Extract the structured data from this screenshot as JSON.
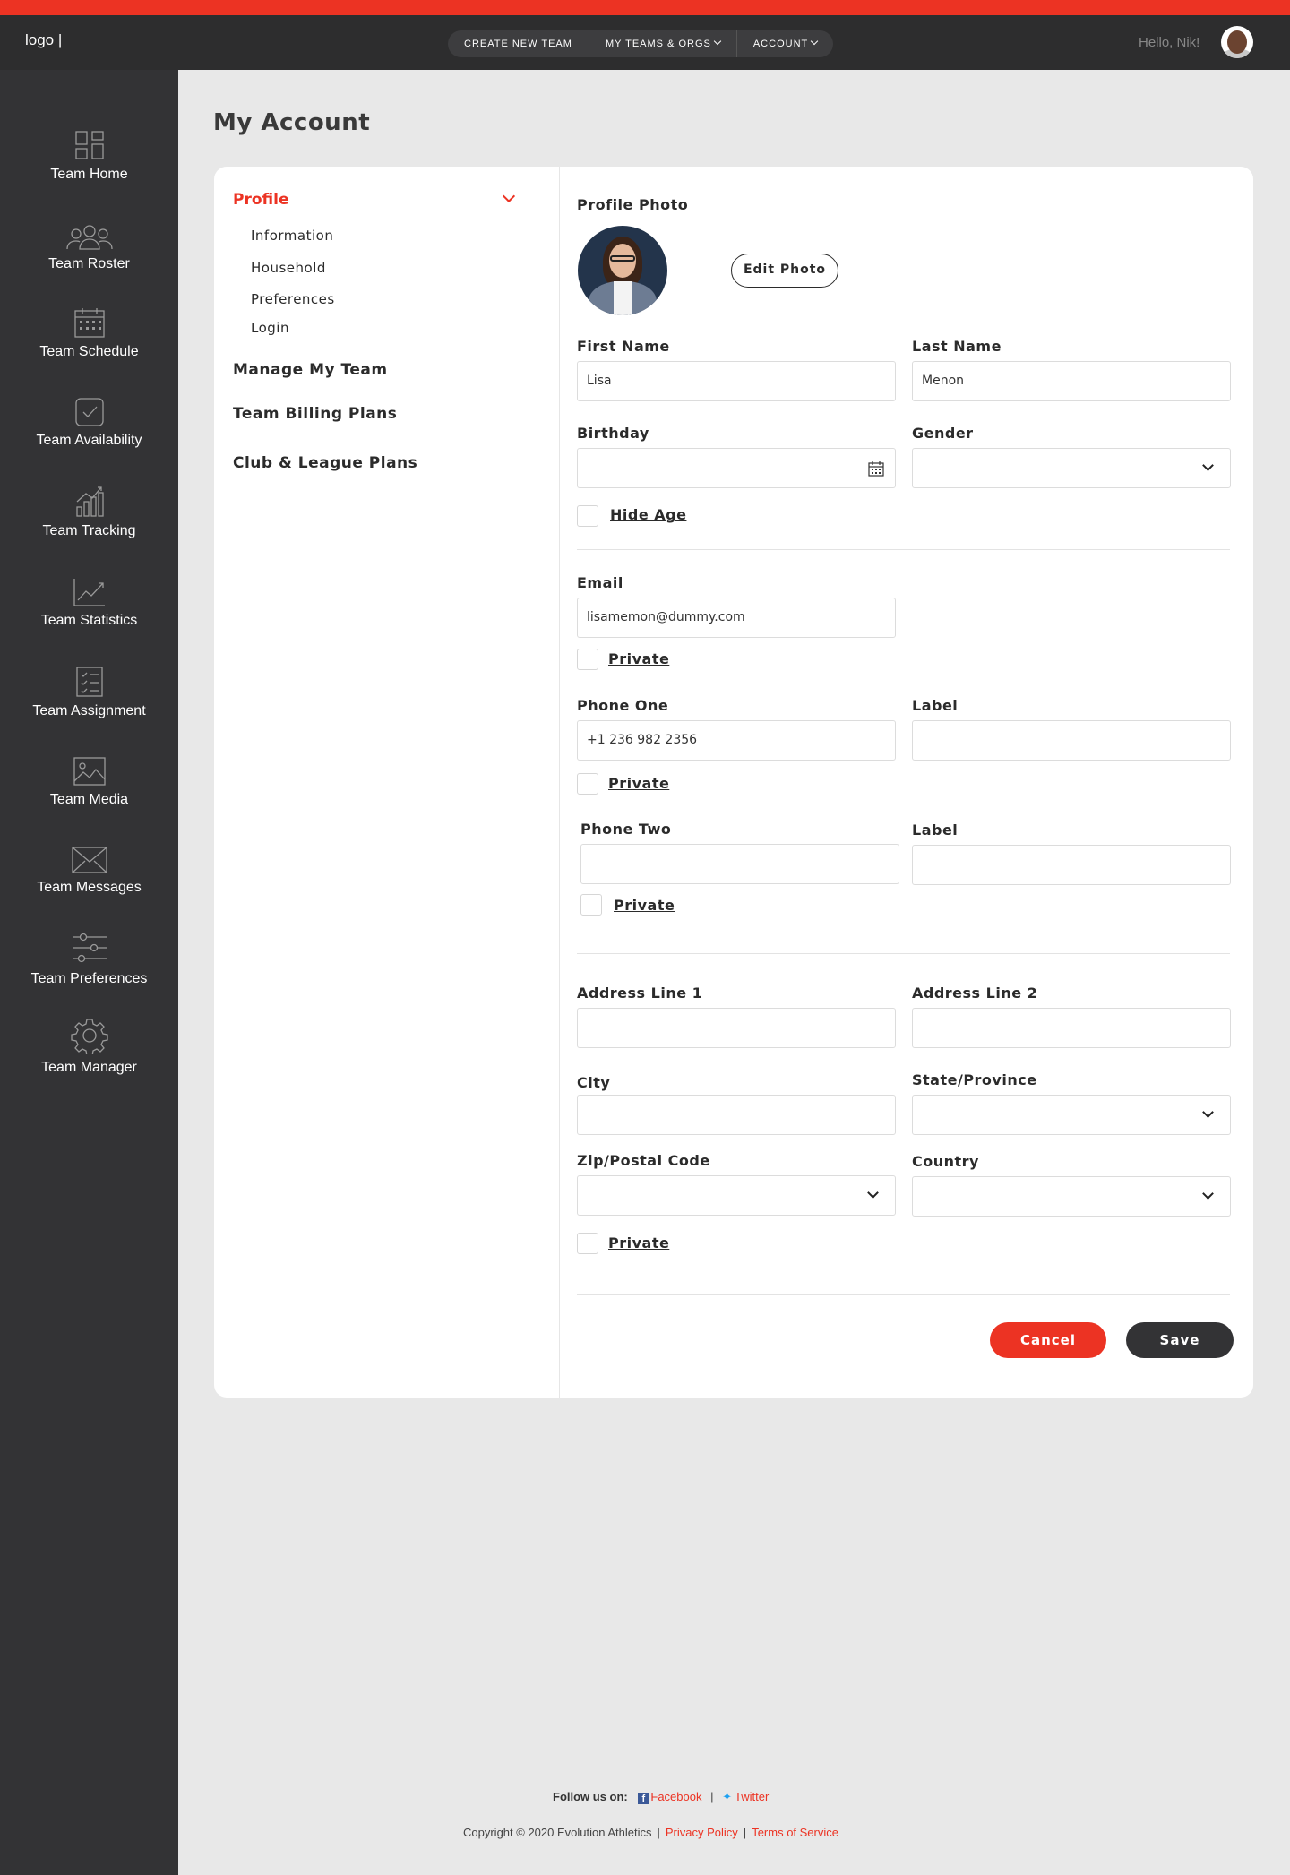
{
  "header": {
    "logo": "logo |",
    "nav": [
      "CREATE NEW TEAM",
      "MY TEAMS & ORGS",
      "ACCOUNT"
    ],
    "greeting": "Hello, Nik!"
  },
  "sidebar": {
    "items": [
      {
        "label": "Team Home",
        "icon": "dashboard-icon"
      },
      {
        "label": "Team Roster",
        "icon": "users-icon"
      },
      {
        "label": "Team Schedule",
        "icon": "calendar-icon"
      },
      {
        "label": "Team Availability",
        "icon": "checkmark-icon"
      },
      {
        "label": "Team Tracking",
        "icon": "bar-chart-icon"
      },
      {
        "label": "Team Statistics",
        "icon": "line-chart-icon"
      },
      {
        "label": "Team Assignment",
        "icon": "checklist-icon"
      },
      {
        "label": "Team Media",
        "icon": "image-icon"
      },
      {
        "label": "Team Messages",
        "icon": "envelope-icon"
      },
      {
        "label": "Team Preferences",
        "icon": "sliders-icon"
      },
      {
        "label": "Team Manager",
        "icon": "gear-icon"
      }
    ]
  },
  "page_title": "My Account",
  "menu": {
    "profile": "Profile",
    "profile_subitems": [
      "Information",
      "Household",
      "Preferences",
      "Login"
    ],
    "items": [
      "Manage My Team",
      "Team Billing Plans",
      "Club & League Plans"
    ]
  },
  "form": {
    "profile_photo_label": "Profile Photo",
    "edit_photo": "Edit Photo",
    "first_name_label": "First Name",
    "first_name_value": "Lisa",
    "last_name_label": "Last Name",
    "last_name_value": "Menon",
    "birthday_label": "Birthday",
    "gender_label": "Gender",
    "hide_age": "Hide Age",
    "email_label": "Email",
    "email_value": "lisamemon@dummy.com",
    "private": "Private",
    "phone_one_label": "Phone One",
    "phone_one_value": "+1 236 982 2356",
    "label_label": "Label",
    "phone_two_label": "Phone Two",
    "address1_label": "Address Line 1",
    "address2_label": "Address Line 2",
    "city_label": "City",
    "state_label": "State/Province",
    "zip_label": "Zip/Postal Code",
    "country_label": "Country",
    "cancel": "Cancel",
    "save": "Save"
  },
  "footer": {
    "follow_label": "Follow us on:",
    "facebook": "Facebook",
    "twitter": "Twitter",
    "copyright": "Copyright © 2020 Evolution Athletics",
    "privacy": "Privacy Policy",
    "terms": "Terms of Service"
  },
  "colors": {
    "accent": "#ec3323",
    "sidebar": "#333335",
    "header": "#2d2d2e"
  }
}
